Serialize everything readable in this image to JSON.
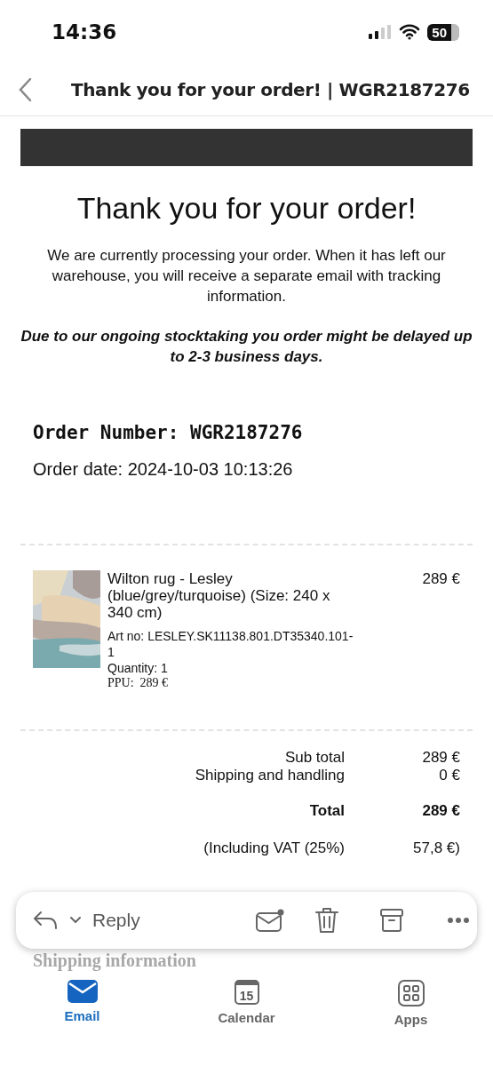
{
  "status_bar": {
    "time": "14:36",
    "battery": "50"
  },
  "header": {
    "title": "Thank you for your order! | WGR2187276"
  },
  "email": {
    "heading": "Thank you for your order!",
    "intro": "We are currently processing your order. When it has left our warehouse, you will receive a separate email with tracking information.",
    "notice": "Due to our ongoing stocktaking you order might be delayed up to 2-3 business days.",
    "order_number": "Order Number: WGR2187276",
    "order_date": "Order date: 2024-10-03 10:13:26",
    "items": [
      {
        "kind": "picture",
        "name": "Wilton rug - Lesley (blue/grey/turquoise) (Size: 240 x 340 cm)",
        "art_no": "Art no: LESLEY.SK11138.801.DT35340.101-1",
        "quantity": "Quantity: 1",
        "ppu": "PPU:  289 €",
        "price": "289 €"
      }
    ],
    "totals": [
      {
        "label": "Sub total",
        "value": "289 €",
        "kind": "plain"
      },
      {
        "label": "Shipping and handling",
        "value": "0 €",
        "kind": "plain"
      },
      {
        "label": "Total",
        "value": "289 €",
        "kind": "total"
      },
      {
        "label": "(Including VAT (25%)",
        "value": "57,8 €)",
        "kind": "vat"
      }
    ],
    "next_section": "Shipping information"
  },
  "reply_bar": {
    "label": "Reply"
  },
  "tabs": [
    {
      "label": "Email",
      "selected": true,
      "kind": "mail"
    },
    {
      "label": "Calendar",
      "selected": false,
      "kind": "calendar",
      "day": "15"
    },
    {
      "label": "Apps",
      "selected": false,
      "kind": "apps"
    }
  ]
}
